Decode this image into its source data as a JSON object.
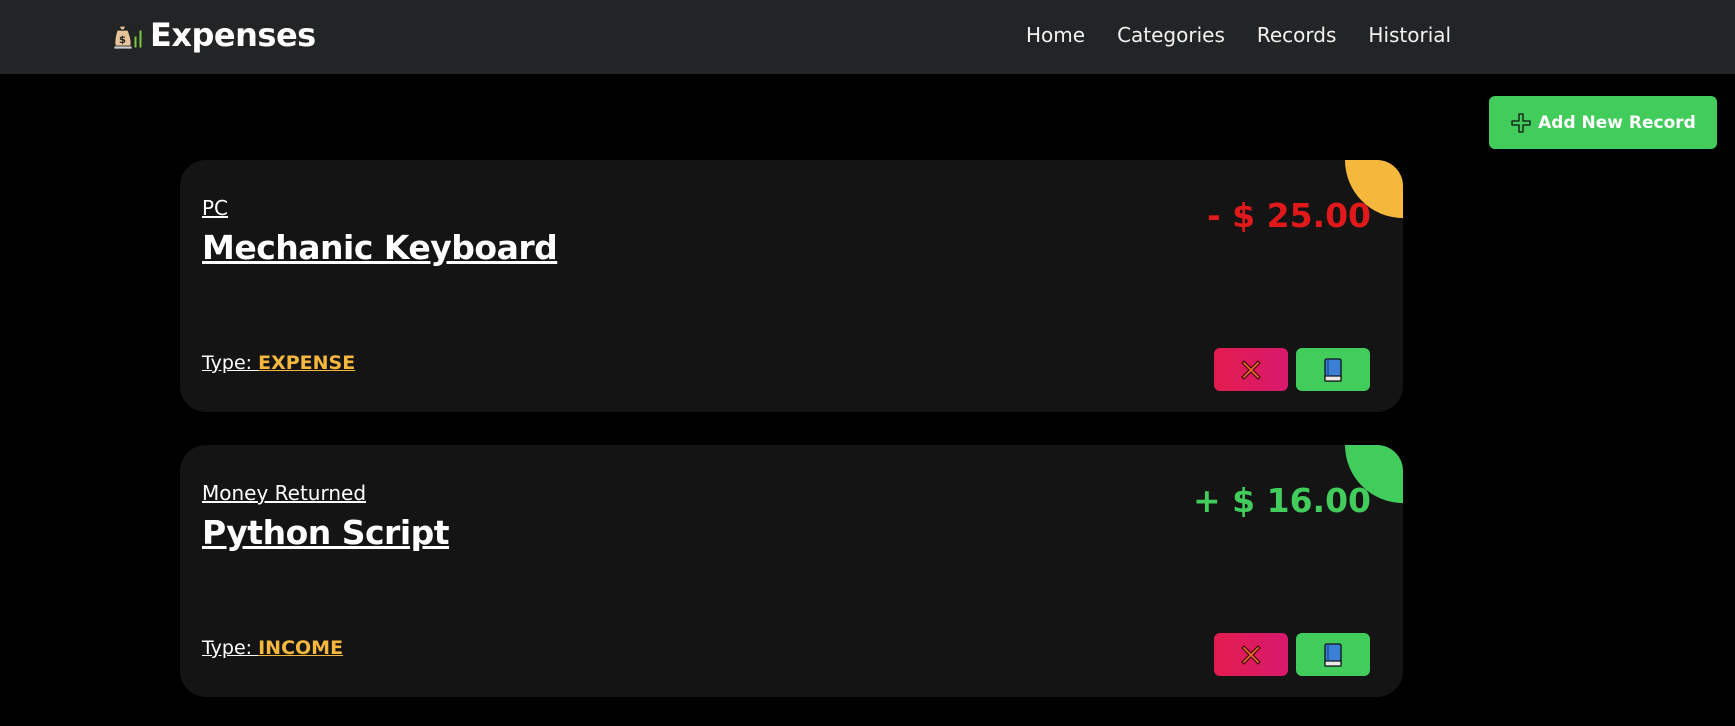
{
  "app": {
    "title": "Expenses",
    "logo_icon": "money-bag-chart-icon"
  },
  "nav": {
    "items": [
      {
        "label": "Home"
      },
      {
        "label": "Categories"
      },
      {
        "label": "Records"
      },
      {
        "label": "Historial"
      }
    ]
  },
  "actions": {
    "add_label": "Add New Record",
    "add_icon": "plus-icon"
  },
  "records": [
    {
      "category": "PC",
      "title": "Mechanic Keyboard",
      "amount": "- $ 25.00",
      "amount_color": "#e1191b",
      "type_label": "Type:",
      "type_value": "EXPENSE",
      "corner_color": "#f5b83d",
      "delete_icon": "close-icon",
      "edit_icon": "book-icon"
    },
    {
      "category": "Money Returned",
      "title": "Python Script",
      "amount": "+ $ 16.00",
      "amount_color": "#41cc5c",
      "type_label": "Type:",
      "type_value": "INCOME",
      "corner_color": "#41cc5c",
      "delete_icon": "close-icon",
      "edit_icon": "book-icon"
    }
  ],
  "colors": {
    "navbar_bg": "#232425",
    "page_bg": "#000000",
    "card_bg": "#141414",
    "accent_green": "#41cc5c",
    "accent_red": "#e31c4f",
    "accent_orange": "#f5b83d"
  }
}
